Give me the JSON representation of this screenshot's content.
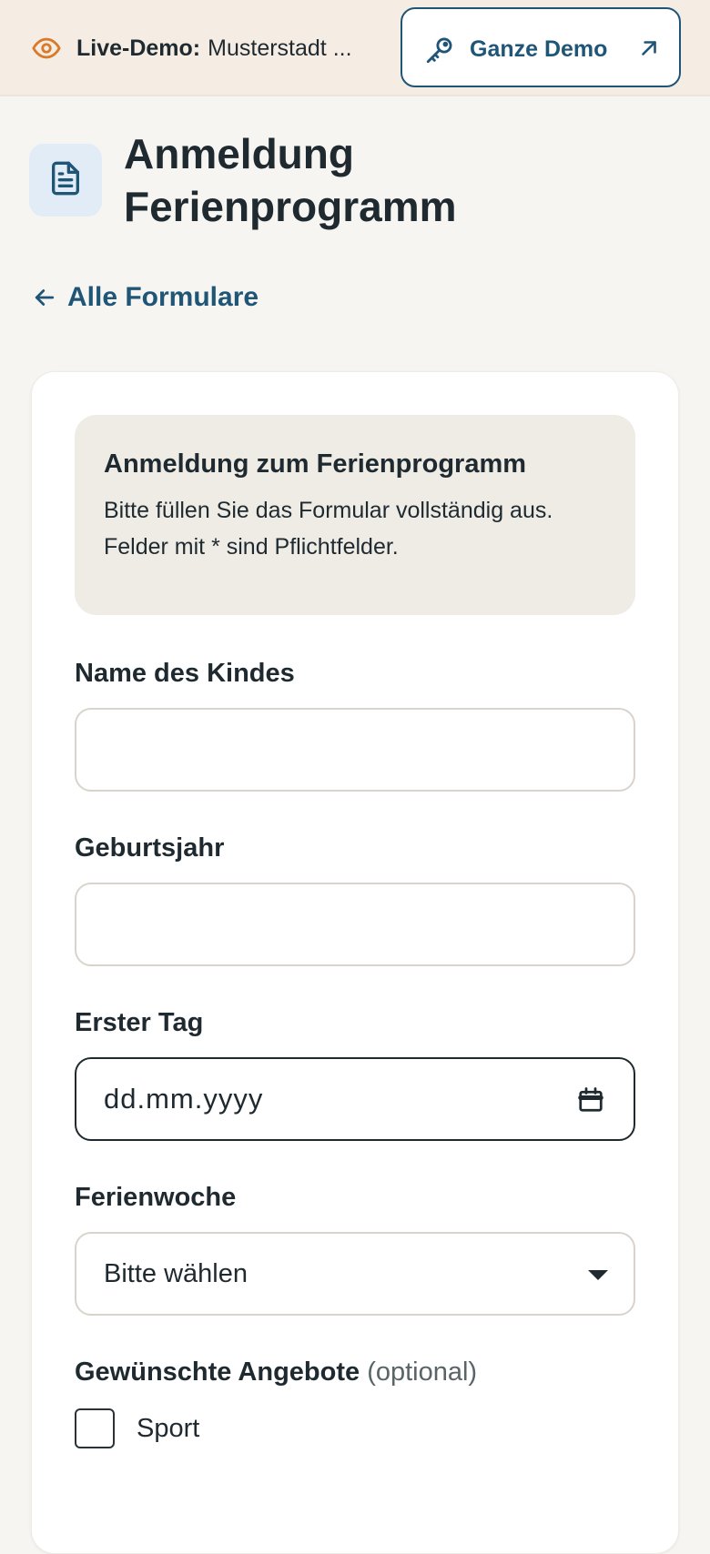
{
  "banner": {
    "prefix": "Live-Demo:",
    "location": "Musterstadt ...",
    "demo_button": "Ganze Demo"
  },
  "header": {
    "title": "Anmeldung Ferienprogramm",
    "back_link": "Alle Formulare"
  },
  "form": {
    "intro_title": "Anmeldung zum Ferienprogramm",
    "intro_text": "Bitte füllen Sie das Formular vollständig aus. Felder mit * sind Pflichtfelder.",
    "fields": {
      "child_name": {
        "label": "Name des Kindes",
        "value": ""
      },
      "birth_year": {
        "label": "Geburtsjahr",
        "value": ""
      },
      "first_day": {
        "label": "Erster Tag",
        "value": "dd.mm.yyyy"
      },
      "week": {
        "label": "Ferienwoche",
        "value": "Bitte wählen"
      }
    },
    "offers": {
      "label": "Gewünschte Angebote",
      "optional": "(optional)",
      "options": [
        {
          "label": "Sport",
          "checked": false
        }
      ]
    }
  },
  "colors": {
    "accent": "#1f5577",
    "eye_icon": "#d97a2b",
    "banner_bg": "#f5ede4",
    "page_bg": "#f7f5f1",
    "intro_bg": "#efece6"
  },
  "icons": {
    "banner": "eye-icon",
    "demo_button": "key-icon",
    "demo_button_trailing": "external-arrow-icon",
    "header": "document-icon",
    "back": "arrow-left-icon",
    "date": "calendar-icon",
    "select": "caret-down-icon"
  }
}
